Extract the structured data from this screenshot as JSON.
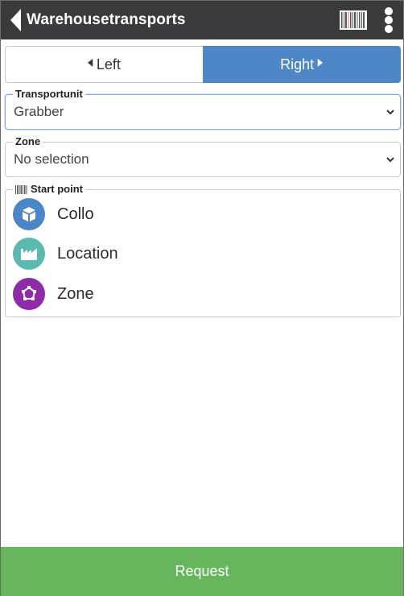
{
  "header": {
    "title": "Warehousetransports",
    "back_icon": "chevron-left-icon",
    "barcode_icon": "barcode-icon",
    "menu_icon": "more-vertical-icon"
  },
  "direction_toggle": {
    "left_label": "Left",
    "right_label": "Right",
    "selected": "Right",
    "left_icon": "arrow-left-icon",
    "right_icon": "arrow-right-icon"
  },
  "transportunit": {
    "legend": "Transportunit",
    "value": "Grabber"
  },
  "zone": {
    "legend": "Zone",
    "value": "No selection"
  },
  "start_point": {
    "legend": "Start point",
    "items": [
      {
        "label": "Collo",
        "icon": "box-icon",
        "color": "#4b86c6"
      },
      {
        "label": "Location",
        "icon": "factory-icon",
        "color": "#5bbab0"
      },
      {
        "label": "Zone",
        "icon": "polygon-icon",
        "color": "#8f2aa8"
      }
    ]
  },
  "footer": {
    "request_label": "Request"
  },
  "colors": {
    "header_bg": "#3b3a3d",
    "accent_blue": "#4d87c7",
    "request_green": "#67b65e"
  }
}
